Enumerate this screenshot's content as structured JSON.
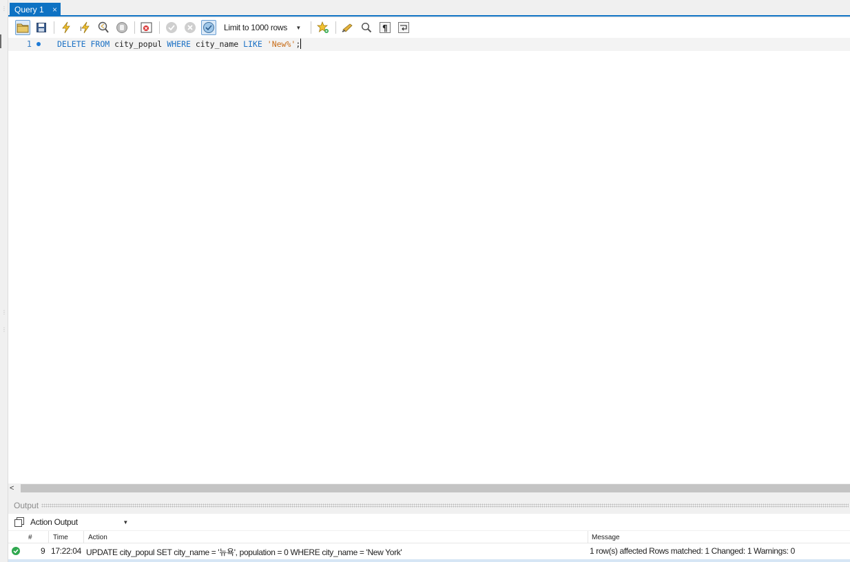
{
  "tabs": [
    {
      "label": "Query 1",
      "close": "×"
    }
  ],
  "toolbar": {
    "limit_select": "Limit to 1000 rows",
    "icons": [
      "open-file-icon",
      "save-icon",
      "execute-icon",
      "execute-current-icon",
      "explain-icon",
      "stop-icon",
      "toggle-errors-icon",
      "commit-icon",
      "rollback-icon",
      "autocommit-icon",
      "bookmark-icon",
      "beautify-icon",
      "find-icon",
      "invisible-chars-icon",
      "word-wrap-icon"
    ]
  },
  "editor": {
    "line_number": "1",
    "tokens": {
      "kw_delete": "DELETE",
      "kw_from": "FROM",
      "table": "city_popul",
      "kw_where": "WHERE",
      "column": "city_name",
      "kw_like": "LIKE",
      "pattern": "'New%'",
      "terminator": ";"
    }
  },
  "scrollbar": {
    "left_arrow": "<"
  },
  "output": {
    "title": "Output",
    "mode_select": "Action Output",
    "columns": {
      "num": "#",
      "time": "Time",
      "action": "Action",
      "message": "Message"
    },
    "rows": [
      {
        "status": "success",
        "num": "9",
        "time": "17:22:04",
        "action": "UPDATE city_popul SET city_name = '뉴욕', population = 0 WHERE city_name = 'New York'",
        "message": "1 row(s) affected Rows matched: 1  Changed: 1  Warnings: 0"
      }
    ]
  },
  "colors": {
    "accent": "#0e72c3",
    "keyword": "#1a70c4",
    "string": "#c86d19",
    "success": "#2fa84f"
  }
}
